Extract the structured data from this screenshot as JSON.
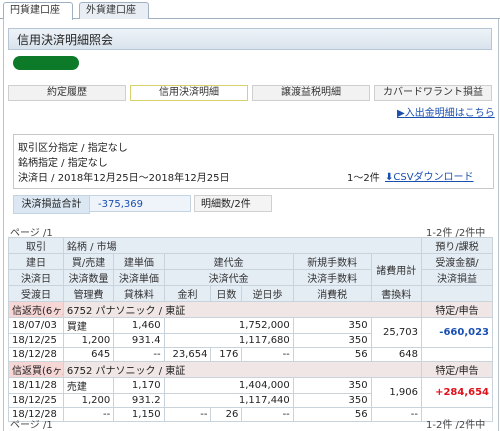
{
  "tabs": {
    "yen": "円貨建口座",
    "foreign": "外貨建口座"
  },
  "page_title": "信用決済明細照会",
  "nav": {
    "contract_history": "約定履歴",
    "margin_settlement": "信用決済明細",
    "transfer_pl": "譲渡益税明細",
    "covered_warrant": "カバードワラント損益"
  },
  "deposit_link": "入出金明細はこちら",
  "conditions": {
    "line1": "取引区分指定 / 指定なし",
    "line2": "銘柄指定 / 指定なし",
    "line3": "決済日 / 2018年12月25日～2018年12月25日",
    "count": "1～2件",
    "csv_link": "CSVダウンロード"
  },
  "summary": {
    "label": "決済損益合計",
    "value": "-375,369",
    "count": "明細数/2件"
  },
  "pager": {
    "page": "ページ /1",
    "range": "1-2件 /2件中"
  },
  "table": {
    "header1": [
      "取引",
      "銘柄 / 市場",
      "預り/課税"
    ],
    "header2": [
      "建日",
      "買/売建",
      "建単価",
      "建代金",
      "新規手数料",
      "諸費用計",
      "受渡金額/"
    ],
    "header3": [
      "決済日",
      "決済数量",
      "決済単価",
      "決済代金",
      "決済手数料",
      "決済損益"
    ],
    "header4": [
      "受渡日",
      "管理費",
      "貸株料",
      "金利",
      "日数",
      "逆日歩",
      "消費税",
      "書換料"
    ],
    "rows": [
      {
        "type": "信返売(6ヶ月)",
        "security": "6752 パナソニック / 東証",
        "account": "特定/申告",
        "build_date": "18/07/03",
        "side": "買建",
        "build_price": "1,460",
        "build_amount": "1,752,000",
        "new_fee": "350",
        "settle_date": "18/12/25",
        "qty": "1,200",
        "settle_price": "931.4",
        "settle_amount": "1,117,680",
        "settle_fee": "350",
        "costs_total": "25,703",
        "pl": "-660,023",
        "delivery_date": "18/12/28",
        "mgmt_fee": "645",
        "lend_fee": "--",
        "interest": "23,654",
        "days": "176",
        "reverse": "--",
        "tax": "56",
        "rewrite": "648"
      },
      {
        "type": "信返買(6ヶ月)",
        "security": "6752 パナソニック / 東証",
        "account": "特定/申告",
        "build_date": "18/11/28",
        "side": "売建",
        "build_price": "1,170",
        "build_amount": "1,404,000",
        "new_fee": "350",
        "settle_date": "18/12/25",
        "qty": "1,200",
        "settle_price": "931.2",
        "settle_amount": "1,117,440",
        "settle_fee": "350",
        "costs_total": "1,906",
        "pl": "+284,654",
        "delivery_date": "18/12/28",
        "mgmt_fee": "--",
        "lend_fee": "1,150",
        "interest": "--",
        "days": "26",
        "reverse": "--",
        "tax": "56",
        "rewrite": "--"
      }
    ]
  },
  "colors": {
    "blue_link": "#1a4fb0",
    "loss": "#1a4fb0",
    "profit": "#e0101a",
    "header_bg": "#e4ecf4"
  }
}
